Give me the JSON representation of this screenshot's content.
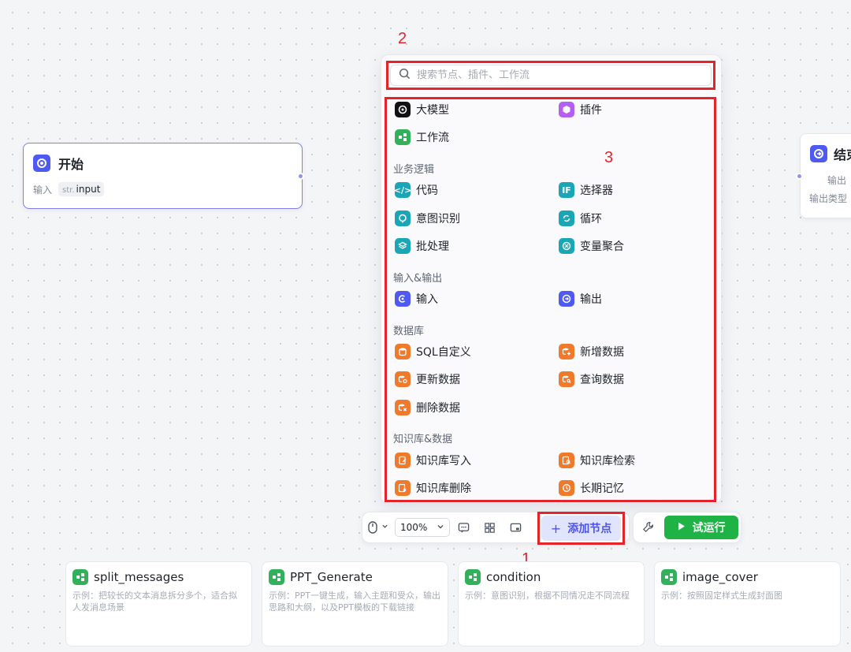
{
  "start_node": {
    "title": "开始",
    "field_label": "输入",
    "field_type": "str.",
    "field_name": "input"
  },
  "end_node": {
    "title": "结束",
    "row1": "输出",
    "row2": "输出类型"
  },
  "panel": {
    "search_placeholder": "搜索节点、插件、工作流",
    "top_items": [
      {
        "label": "大模型",
        "icon": "llm-icon",
        "color": "#111111"
      },
      {
        "label": "插件",
        "icon": "plugin-icon",
        "color": "#b45ef2"
      },
      {
        "label": "工作流",
        "icon": "workflow-icon",
        "color": "#32b15a"
      }
    ],
    "sections": [
      {
        "title": "业务逻辑",
        "items": [
          {
            "label": "代码",
            "icon": "code-icon",
            "color": "#1aa6b7"
          },
          {
            "label": "选择器",
            "icon": "if-icon",
            "color": "#1aa6b7"
          },
          {
            "label": "意图识别",
            "icon": "intent-icon",
            "color": "#1aa6b7"
          },
          {
            "label": "循环",
            "icon": "loop-icon",
            "color": "#1aa6b7"
          },
          {
            "label": "批处理",
            "icon": "batch-icon",
            "color": "#1aa6b7"
          },
          {
            "label": "变量聚合",
            "icon": "aggregate-icon",
            "color": "#1aa6b7"
          }
        ]
      },
      {
        "title": "输入&输出",
        "items": [
          {
            "label": "输入",
            "icon": "input-icon",
            "color": "#4f5bf0"
          },
          {
            "label": "输出",
            "icon": "output-icon",
            "color": "#4f5bf0"
          }
        ]
      },
      {
        "title": "数据库",
        "items": [
          {
            "label": "SQL自定义",
            "icon": "database-icon",
            "color": "#f07a2c"
          },
          {
            "label": "新增数据",
            "icon": "database-add-icon",
            "color": "#f07a2c"
          },
          {
            "label": "更新数据",
            "icon": "database-update-icon",
            "color": "#f07a2c"
          },
          {
            "label": "查询数据",
            "icon": "database-query-icon",
            "color": "#f07a2c"
          },
          {
            "label": "删除数据",
            "icon": "database-delete-icon",
            "color": "#f07a2c"
          }
        ]
      },
      {
        "title": "知识库&数据",
        "items": [
          {
            "label": "知识库写入",
            "icon": "kb-write-icon",
            "color": "#f07a2c"
          },
          {
            "label": "知识库检索",
            "icon": "kb-search-icon",
            "color": "#f07a2c"
          },
          {
            "label": "知识库删除",
            "icon": "kb-delete-icon",
            "color": "#f07a2c"
          },
          {
            "label": "长期记忆",
            "icon": "memory-icon",
            "color": "#f07a2c"
          }
        ]
      }
    ]
  },
  "toolbar": {
    "zoom": "100%",
    "add_node_label": "添加节点",
    "run_label": "试运行"
  },
  "annotations": [
    "1",
    "2",
    "3"
  ],
  "templates": [
    {
      "name": "split_messages",
      "desc": "示例：把较长的文本消息拆分多个，适合拟人发消息场景"
    },
    {
      "name": "PPT_Generate",
      "desc": "示例：PPT一键生成，输入主题和受众，输出思路和大纲，以及PPT模板的下载链接"
    },
    {
      "name": "condition",
      "desc": "示例：意图识别，根据不同情况走不同流程"
    },
    {
      "name": "image_cover",
      "desc": "示例：按照固定样式生成封面图"
    }
  ]
}
